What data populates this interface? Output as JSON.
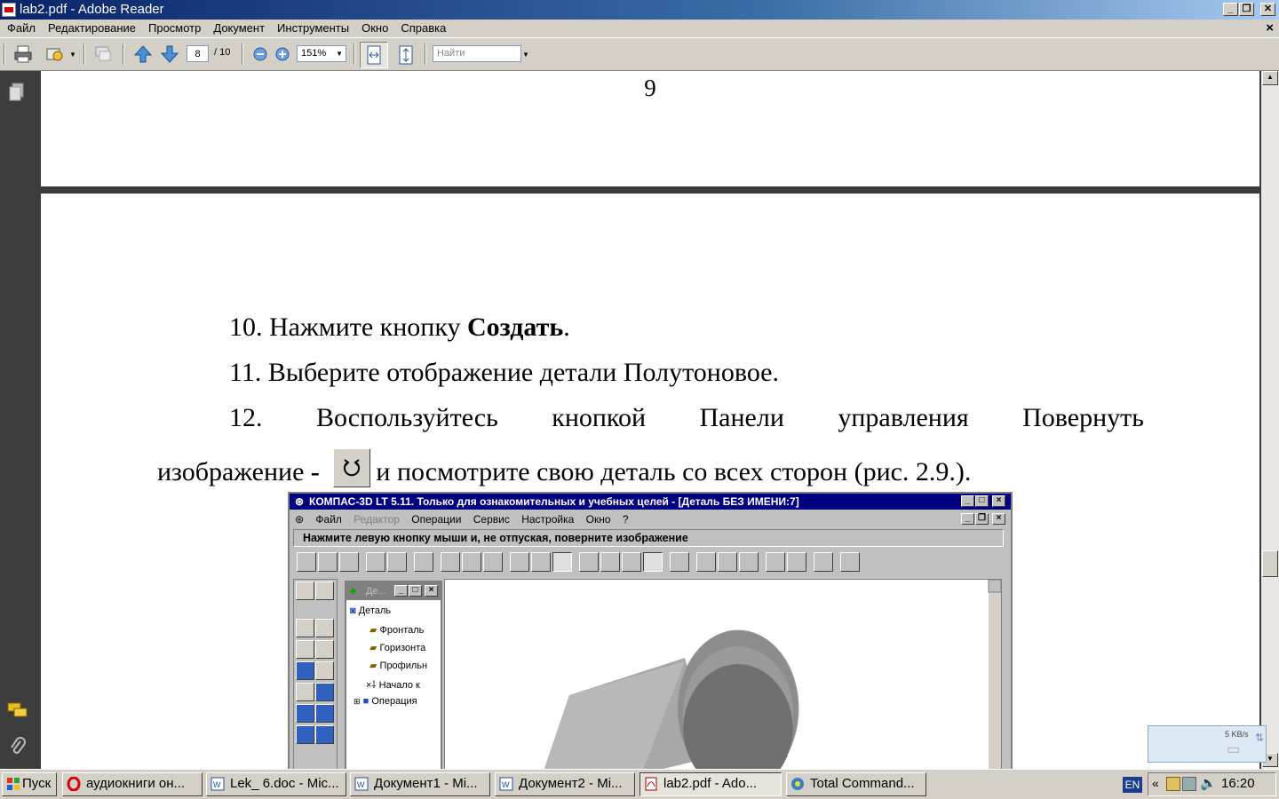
{
  "window": {
    "title": "lab2.pdf - Adobe Reader",
    "minimize_label": "_",
    "restore_label": "❐",
    "close_label": "✕",
    "doc_close_label": "×"
  },
  "menu": {
    "items": [
      "Файл",
      "Редактирование",
      "Просмотр",
      "Документ",
      "Инструменты",
      "Окно",
      "Справка"
    ]
  },
  "toolbar": {
    "current_page": "8",
    "total_pages": "/ 10",
    "zoom": "151%",
    "find_placeholder": "Найти"
  },
  "document": {
    "page_number": "9",
    "line10_prefix": "10. Нажмите кнопку ",
    "line10_bold": "Создать",
    "line10_suffix": ".",
    "line11": "11. Выберите отображение детали Полутоновое.",
    "line12_words": [
      "12.",
      "Воспользуйтесь",
      "кнопкой",
      "Панели",
      "управления",
      "Повернуть"
    ],
    "line13_prefix": "изображение ",
    "line13_bold": "-",
    "line13_suffix": "и посмотрите свою деталь со всех сторон (рис. 2.9.)."
  },
  "kompas": {
    "title": "КОМПАС-3D LT 5.11. Только для ознакомительных и учебных целей - [Деталь БЕЗ ИМЕНИ:7]",
    "menu": [
      "Файл",
      "Редактор",
      "Операции",
      "Сервис",
      "Настройка",
      "Окно",
      "?"
    ],
    "prompt": "Нажмите левую кнопку мыши и, не отпуская, поверните изображение",
    "tree_title": "Де...",
    "tree_items": [
      "Деталь",
      "Фронталь",
      "Горизонта",
      "Профильн",
      "Начало к",
      "Операция"
    ]
  },
  "taskbar": {
    "start_label": "Пуск",
    "tasks": [
      {
        "label": "аудиокниги он...",
        "icon": "opera-icon"
      },
      {
        "label": "Lek_ 6.doc - Mic...",
        "icon": "word-icon"
      },
      {
        "label": "Документ1 - Mi...",
        "icon": "word-icon"
      },
      {
        "label": "Документ2 - Mi...",
        "icon": "word-icon"
      },
      {
        "label": "lab2.pdf - Ado...",
        "icon": "pdf-icon"
      },
      {
        "label": "Total Command...",
        "icon": "total-commander-icon"
      }
    ],
    "lang": "EN",
    "tray_chevron": "«",
    "clock": "16:20"
  },
  "netmeter": {
    "speed": "5 KB/s"
  },
  "colors": {
    "title_gradient_start": "#0a246a",
    "kompas_title": "#000080",
    "doc_background": "#3b3b3b"
  }
}
